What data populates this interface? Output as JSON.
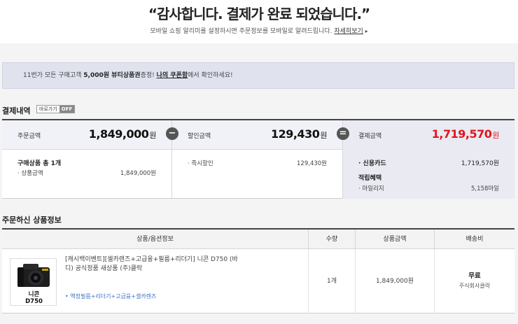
{
  "header": {
    "title": "“감사합니다. 결제가 완료 되었습니다.”",
    "subtitle": "모바일 쇼핑 알리미를 설정하시면 주문정보를 모바일로 알려드립니다.",
    "detail_link": "자세히보기",
    "detail_arrow": "▸"
  },
  "notice": {
    "prefix": "11번가 모든 구매고객 ",
    "highlight": "5,000원 뷰티상품권",
    "middle": "증정! ",
    "link": "나의 쿠폰함",
    "suffix": "에서 확인하세요!"
  },
  "payment": {
    "section_title": "결제내역",
    "shortcut_label": "바로가기",
    "shortcut_state": "OFF",
    "order_amount": {
      "label": "주문금액",
      "value": "1,849,000",
      "unit": "원",
      "purchase_label": "구매상품 총 1개",
      "item_label": "· 상품금액",
      "item_value": "1,849,000원"
    },
    "minus_symbol": "−",
    "discount": {
      "label": "할인금액",
      "value": "129,430",
      "unit": "원",
      "item_label": "· 즉시할인",
      "item_value": "129,430원"
    },
    "equals_symbol": "=",
    "total": {
      "label": "결제금액",
      "value": "1,719,570",
      "unit": "원",
      "method_label": "· 신용카드",
      "method_value": "1,719,570원",
      "reward_label": "적립혜택",
      "mileage_label": "· 마일리지",
      "mileage_value": "5,158마일"
    },
    "accent_color": "#e4141b"
  },
  "products": {
    "section_title": "주문하신 상품정보",
    "columns": [
      "상품/옵션정보",
      "수량",
      "상품금액",
      "배송비"
    ],
    "items": [
      {
        "thumb_brand": "Nikon",
        "thumb_caption_1": "니콘",
        "thumb_caption_2": "D750",
        "name": "[캐시백이벤트][셀카렌즈+고급융+필름+리더기] 니콘 D750 (바디) 공식정품 새상품 (주)클락",
        "options": "• 액정필름+리더기+고급융+셀카렌즈",
        "quantity": "1개",
        "price": "1,849,000원",
        "shipping": "무료",
        "shipper": "주식회사클락"
      }
    ]
  }
}
